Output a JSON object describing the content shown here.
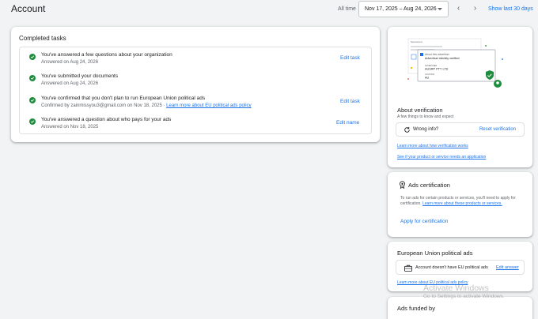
{
  "header": {
    "title": "Account",
    "all_time_label": "All time",
    "date_range": "Nov 17, 2025 – Aug 24, 2026",
    "show_last_label": "Show last 30 days"
  },
  "completed_tasks": {
    "heading": "Completed tasks",
    "items": [
      {
        "title": "You've answered a few questions about your organization",
        "sub": "Answered on Aug 24, 2026",
        "action": "Edit task"
      },
      {
        "title": "You've submitted your documents",
        "sub": "Answered on Aug 24, 2026",
        "action": ""
      },
      {
        "title": "You've confirmed that you don't plan to run European Union political ads",
        "sub": "Confirmed by zainmissyou3@gmail.com on Nov 18, 2025 · ",
        "sub_link": "Learn more about EU political ads policy",
        "action": "Edit task"
      },
      {
        "title": "You've answered a question about who pays for your ads",
        "sub": "Answered on Nov 18, 2025",
        "action": "Edit name"
      }
    ]
  },
  "verification": {
    "illustration": {
      "sponsored": "Sponsored",
      "about": "About this advertiser",
      "identity": "Advertiser identity verified",
      "advertiser_label": "ADVERTISER",
      "advertiser": "AUSRP PTY LTD",
      "location_label": "LOCATION",
      "location": "AU"
    },
    "heading": "About verification",
    "sub": "A few things to know and expect",
    "wrong_info": "Wrong info?",
    "reset": "Reset verification",
    "link1": "Learn more about how verification works",
    "link2": "See if your product or service needs an application"
  },
  "certification": {
    "heading": "Ads certification",
    "body": "To run ads for certain products or services, you'll need to apply for certification. ",
    "body_link": "Learn more about these products or services.",
    "apply": "Apply for certification"
  },
  "eu_political": {
    "heading": "European Union political ads",
    "status": "Account doesn't have EU political ads",
    "edit": "Edit answer",
    "link": "Learn more about EU political ads policy"
  },
  "funded": {
    "heading": "Ads funded by"
  },
  "watermark": {
    "line1": "Activate Windows",
    "line2": "Go to Settings to activate Windows."
  },
  "colors": {
    "accent": "#1a73e8",
    "success": "#1e8e3e"
  },
  "icons": [
    "check-circle-icon",
    "reset-icon",
    "certificate-icon",
    "briefcase-icon",
    "chevron-left-icon",
    "chevron-right-icon",
    "dropdown-caret-icon"
  ]
}
